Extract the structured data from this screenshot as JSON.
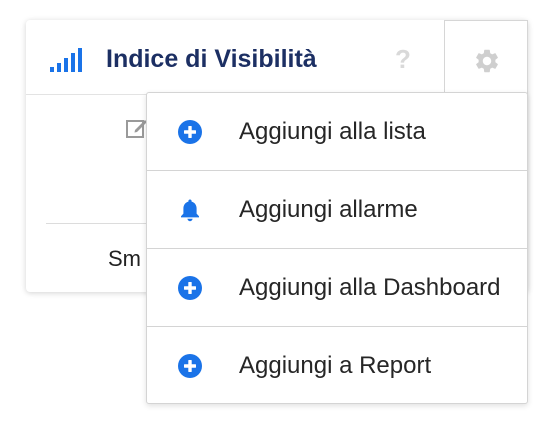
{
  "widget": {
    "title": "Indice di Visibilità",
    "help_symbol": "?",
    "partial_text": "Sm",
    "icons": {
      "signal": "signal-bars-icon",
      "help": "question-mark-icon",
      "settings": "gear-icon",
      "edit": "edit-icon"
    }
  },
  "menu": {
    "items": [
      {
        "label": "Aggiungi alla lista",
        "icon": "plus-circle-icon"
      },
      {
        "label": "Aggiungi allarme",
        "icon": "bell-icon"
      },
      {
        "label": "Aggiungi alla Dashboard",
        "icon": "plus-circle-icon"
      },
      {
        "label": "Aggiungi a Report",
        "icon": "plus-circle-icon"
      }
    ]
  },
  "colors": {
    "accent_blue": "#1a73e8",
    "title_navy": "#1c2f63",
    "icon_gray": "#d9d9d9"
  }
}
